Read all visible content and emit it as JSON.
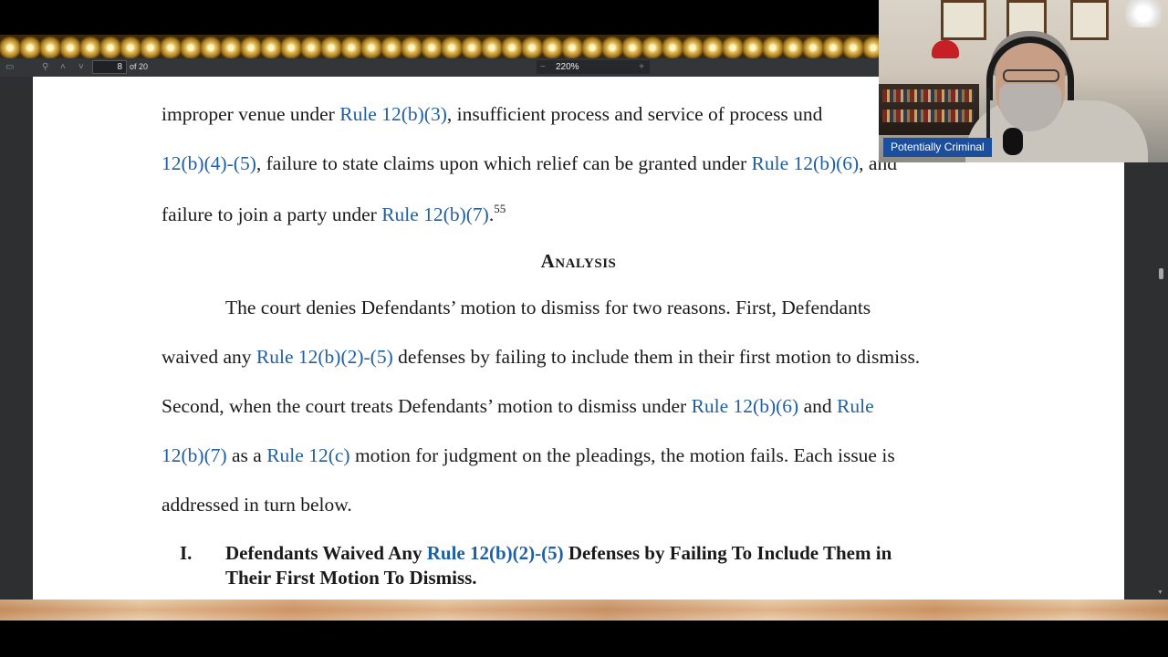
{
  "viewer": {
    "current_page": "8",
    "page_count_label": "of 20",
    "zoom": "220%",
    "zoom_minus": "−",
    "zoom_plus": "+"
  },
  "document": {
    "para1": {
      "l1_a": "improper venue under ",
      "l1_link": "Rule 12(b)(3)",
      "l1_b": ", insufficient process and service of process und",
      "l2_link1": "12(b)(4)-(5)",
      "l2_a": ", failure to state claims upon which relief can be granted under ",
      "l2_link2": "Rule 12(b)(6)",
      "l2_b": ", and",
      "l3_a": "failure to join a party under ",
      "l3_link": "Rule 12(b)(7)",
      "l3_b": ".",
      "footnote": "55"
    },
    "heading": "Analysis",
    "para2": {
      "l1": "The court denies Defendants’ motion to dismiss for two reasons. First, Defendants",
      "l2_a": "waived any ",
      "l2_link": "Rule 12(b)(2)-(5)",
      "l2_b": " defenses by failing to include them in their first motion to dismiss.",
      "l3_a": "Second, when the court treats Defendants’ motion to dismiss under ",
      "l3_link1": "Rule 12(b)(6)",
      "l3_b": " and ",
      "l3_link2": "Rule",
      "l4_link1": "12(b)(7)",
      "l4_a": " as a ",
      "l4_link2": "Rule 12(c)",
      "l4_b": " motion for judgment on the pleadings, the motion fails. Each issue is",
      "l5": "addressed in turn below."
    },
    "section": {
      "number": "I.",
      "title_a": "Defendants Waived Any ",
      "title_link": "Rule 12(b)(2)-(5)",
      "title_b": " Defenses by Failing To Include Them in",
      "title_line2": "Their First Motion To Dismiss."
    }
  },
  "webcam": {
    "name_tag": "Potentially Criminal"
  },
  "colors": {
    "link": "#1f5fa3",
    "name_tag_bg": "#1b4f9e",
    "toolbar_bg": "#323639",
    "viewer_bg": "#525659"
  },
  "icons": [
    "sidebar-toggle-icon",
    "search-icon",
    "chevron-up-icon",
    "chevron-down-icon"
  ]
}
